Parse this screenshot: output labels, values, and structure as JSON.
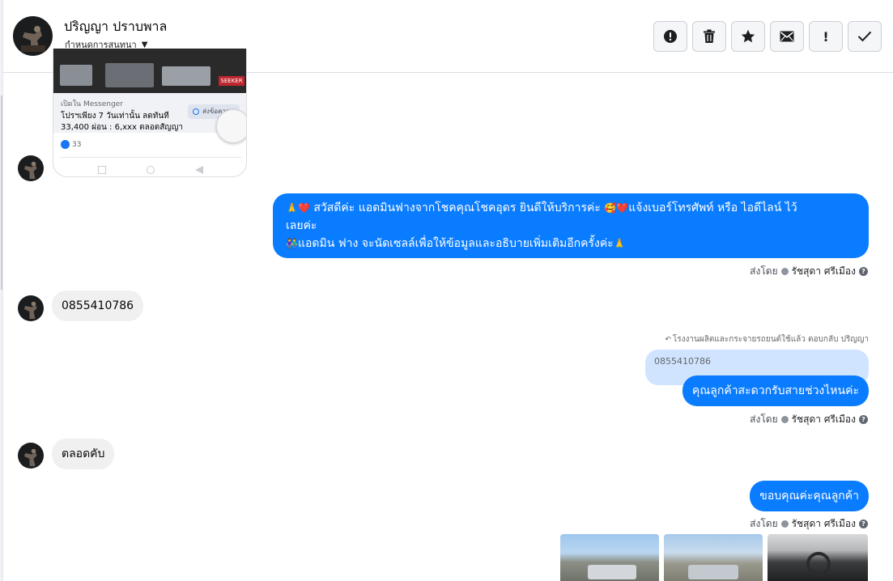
{
  "header": {
    "contact_name": "ปริญญา ปราบพาล",
    "assign_label": "กำหนดการสนทนา",
    "actions": [
      {
        "name": "report-spam-button",
        "icon": "alert-circle-icon"
      },
      {
        "name": "delete-button",
        "icon": "trash-icon"
      },
      {
        "name": "star-button",
        "icon": "star-icon"
      },
      {
        "name": "mark-unread-button",
        "icon": "envelope-icon"
      },
      {
        "name": "follow-up-button",
        "icon": "exclamation-icon",
        "label": "!"
      },
      {
        "name": "mark-done-button",
        "icon": "checkmark-icon"
      }
    ]
  },
  "shared_card": {
    "image_tag": "SEEKER",
    "source": "เปิดใน Messenger",
    "line1": "โปรฯเพียง 7 วันเท่านั้น ลดทันที",
    "line2": "33,400 ผ่อน : 6,xxx ตลอดสัญญา",
    "send_button": "ส่งข้อความ",
    "reaction_count": "33"
  },
  "messages": {
    "greeting": {
      "line1_prefix": "🙏❤️",
      "line1": " สวัสดีค่ะ แอดมินฟางจากโชคคุณโชคอุดร ยินดีให้บริการค่ะ ",
      "line1_emoji": "🥰❤️",
      "line1_suffix": "แจ้งเบอร์โทรศัพท์ หรือ ไอดีไลน์  ไว้",
      "line2": "เลยค่ะ",
      "line3_prefix": "👫",
      "line3": "แอดมิน ฟาง จะนัดเซลล์เพื่อให้ข้อมูลและอธิบายเพิ่มเติมอีกครั้งค่ะ",
      "line3_suffix": "🙏"
    },
    "phone": "0855410786",
    "reply_context": "โรงงานผลิตและกระจายรถยนต์ใช้แล้ว ตอบกลับ ปริญญา",
    "quoted": "0855410786",
    "ask_time": "คุณลูกค้าสะดวกรับสายช่วงไหนค่ะ",
    "anytime": "ตลอดคับ",
    "thanks": "ขอบคุณค่ะคุณลูกค้า"
  },
  "sent_by": {
    "prefix": "ส่งโดย",
    "agent": "รัชสุดา ศรีเมือง",
    "help": "?"
  },
  "colors": {
    "outgoing_bubble": "#0a7cff",
    "incoming_bubble": "#f0f0f0",
    "quoted_bubble": "#d0e4ff"
  }
}
